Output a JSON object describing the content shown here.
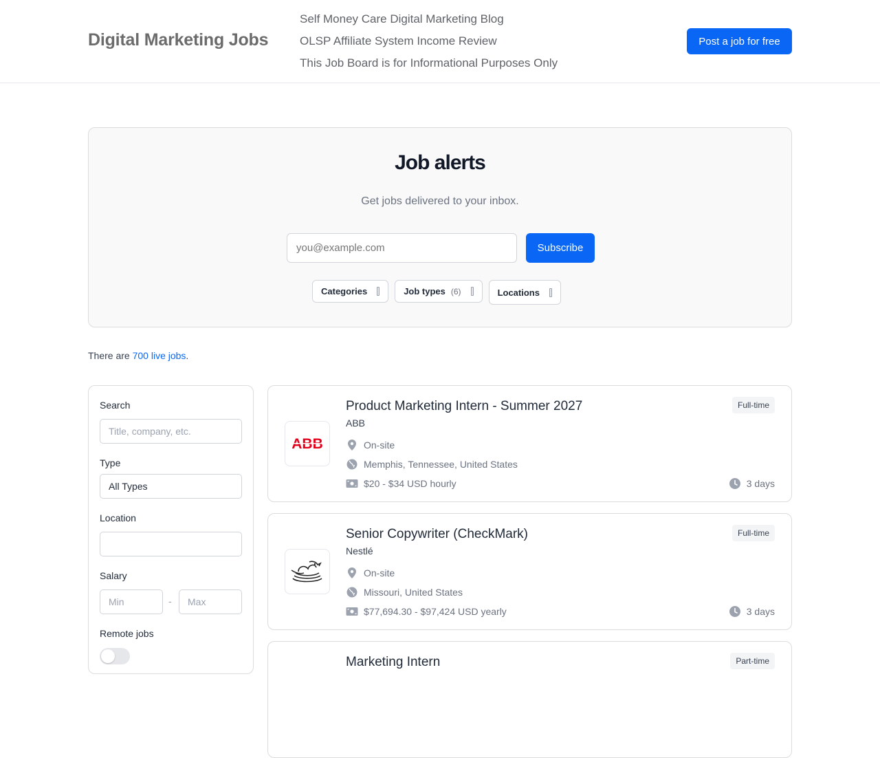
{
  "header": {
    "brand": "Digital Marketing Jobs",
    "nav": [
      "Self Money Care Digital Marketing Blog",
      "OLSP Affiliate System Income Review",
      "This Job Board is for Informational Purposes Only"
    ],
    "post_button": "Post a job for free"
  },
  "alerts": {
    "title": "Job alerts",
    "subtitle": "Get jobs delivered to your inbox.",
    "email_placeholder": "you@example.com",
    "subscribe_label": "Subscribe",
    "filters": {
      "categories": "Categories",
      "job_types": "Job types",
      "job_types_count": "(6)",
      "locations": "Locations"
    }
  },
  "live": {
    "prefix": "There are ",
    "link": "700 live jobs",
    "suffix": "."
  },
  "sidebar": {
    "search_label": "Search",
    "search_placeholder": "Title, company, etc.",
    "type_label": "Type",
    "type_value": "All Types",
    "location_label": "Location",
    "location_value": "",
    "salary_label": "Salary",
    "min_placeholder": "Min",
    "salary_separator": "-",
    "max_placeholder": "Max",
    "remote_label": "Remote jobs",
    "remote_enabled": false
  },
  "jobs": [
    {
      "title": "Product Marketing Intern - Summer 2027",
      "company": "ABB",
      "logo_text": "ABB",
      "work_mode": "On-site",
      "location": "Memphis, Tennessee, United States",
      "salary": "$20 - $34 USD hourly",
      "type": "Full-time",
      "age": "3 days"
    },
    {
      "title": "Senior Copywriter (CheckMark)",
      "company": "Nestlé",
      "logo_text": "",
      "work_mode": "On-site",
      "location": "Missouri, United States",
      "salary": "$77,694.30 - $97,424 USD yearly",
      "type": "Full-time",
      "age": "3 days"
    },
    {
      "title": "Marketing Intern",
      "type": "Part-time"
    }
  ],
  "colors": {
    "accent": "#0a66f5",
    "abb_red": "#e2001a"
  }
}
